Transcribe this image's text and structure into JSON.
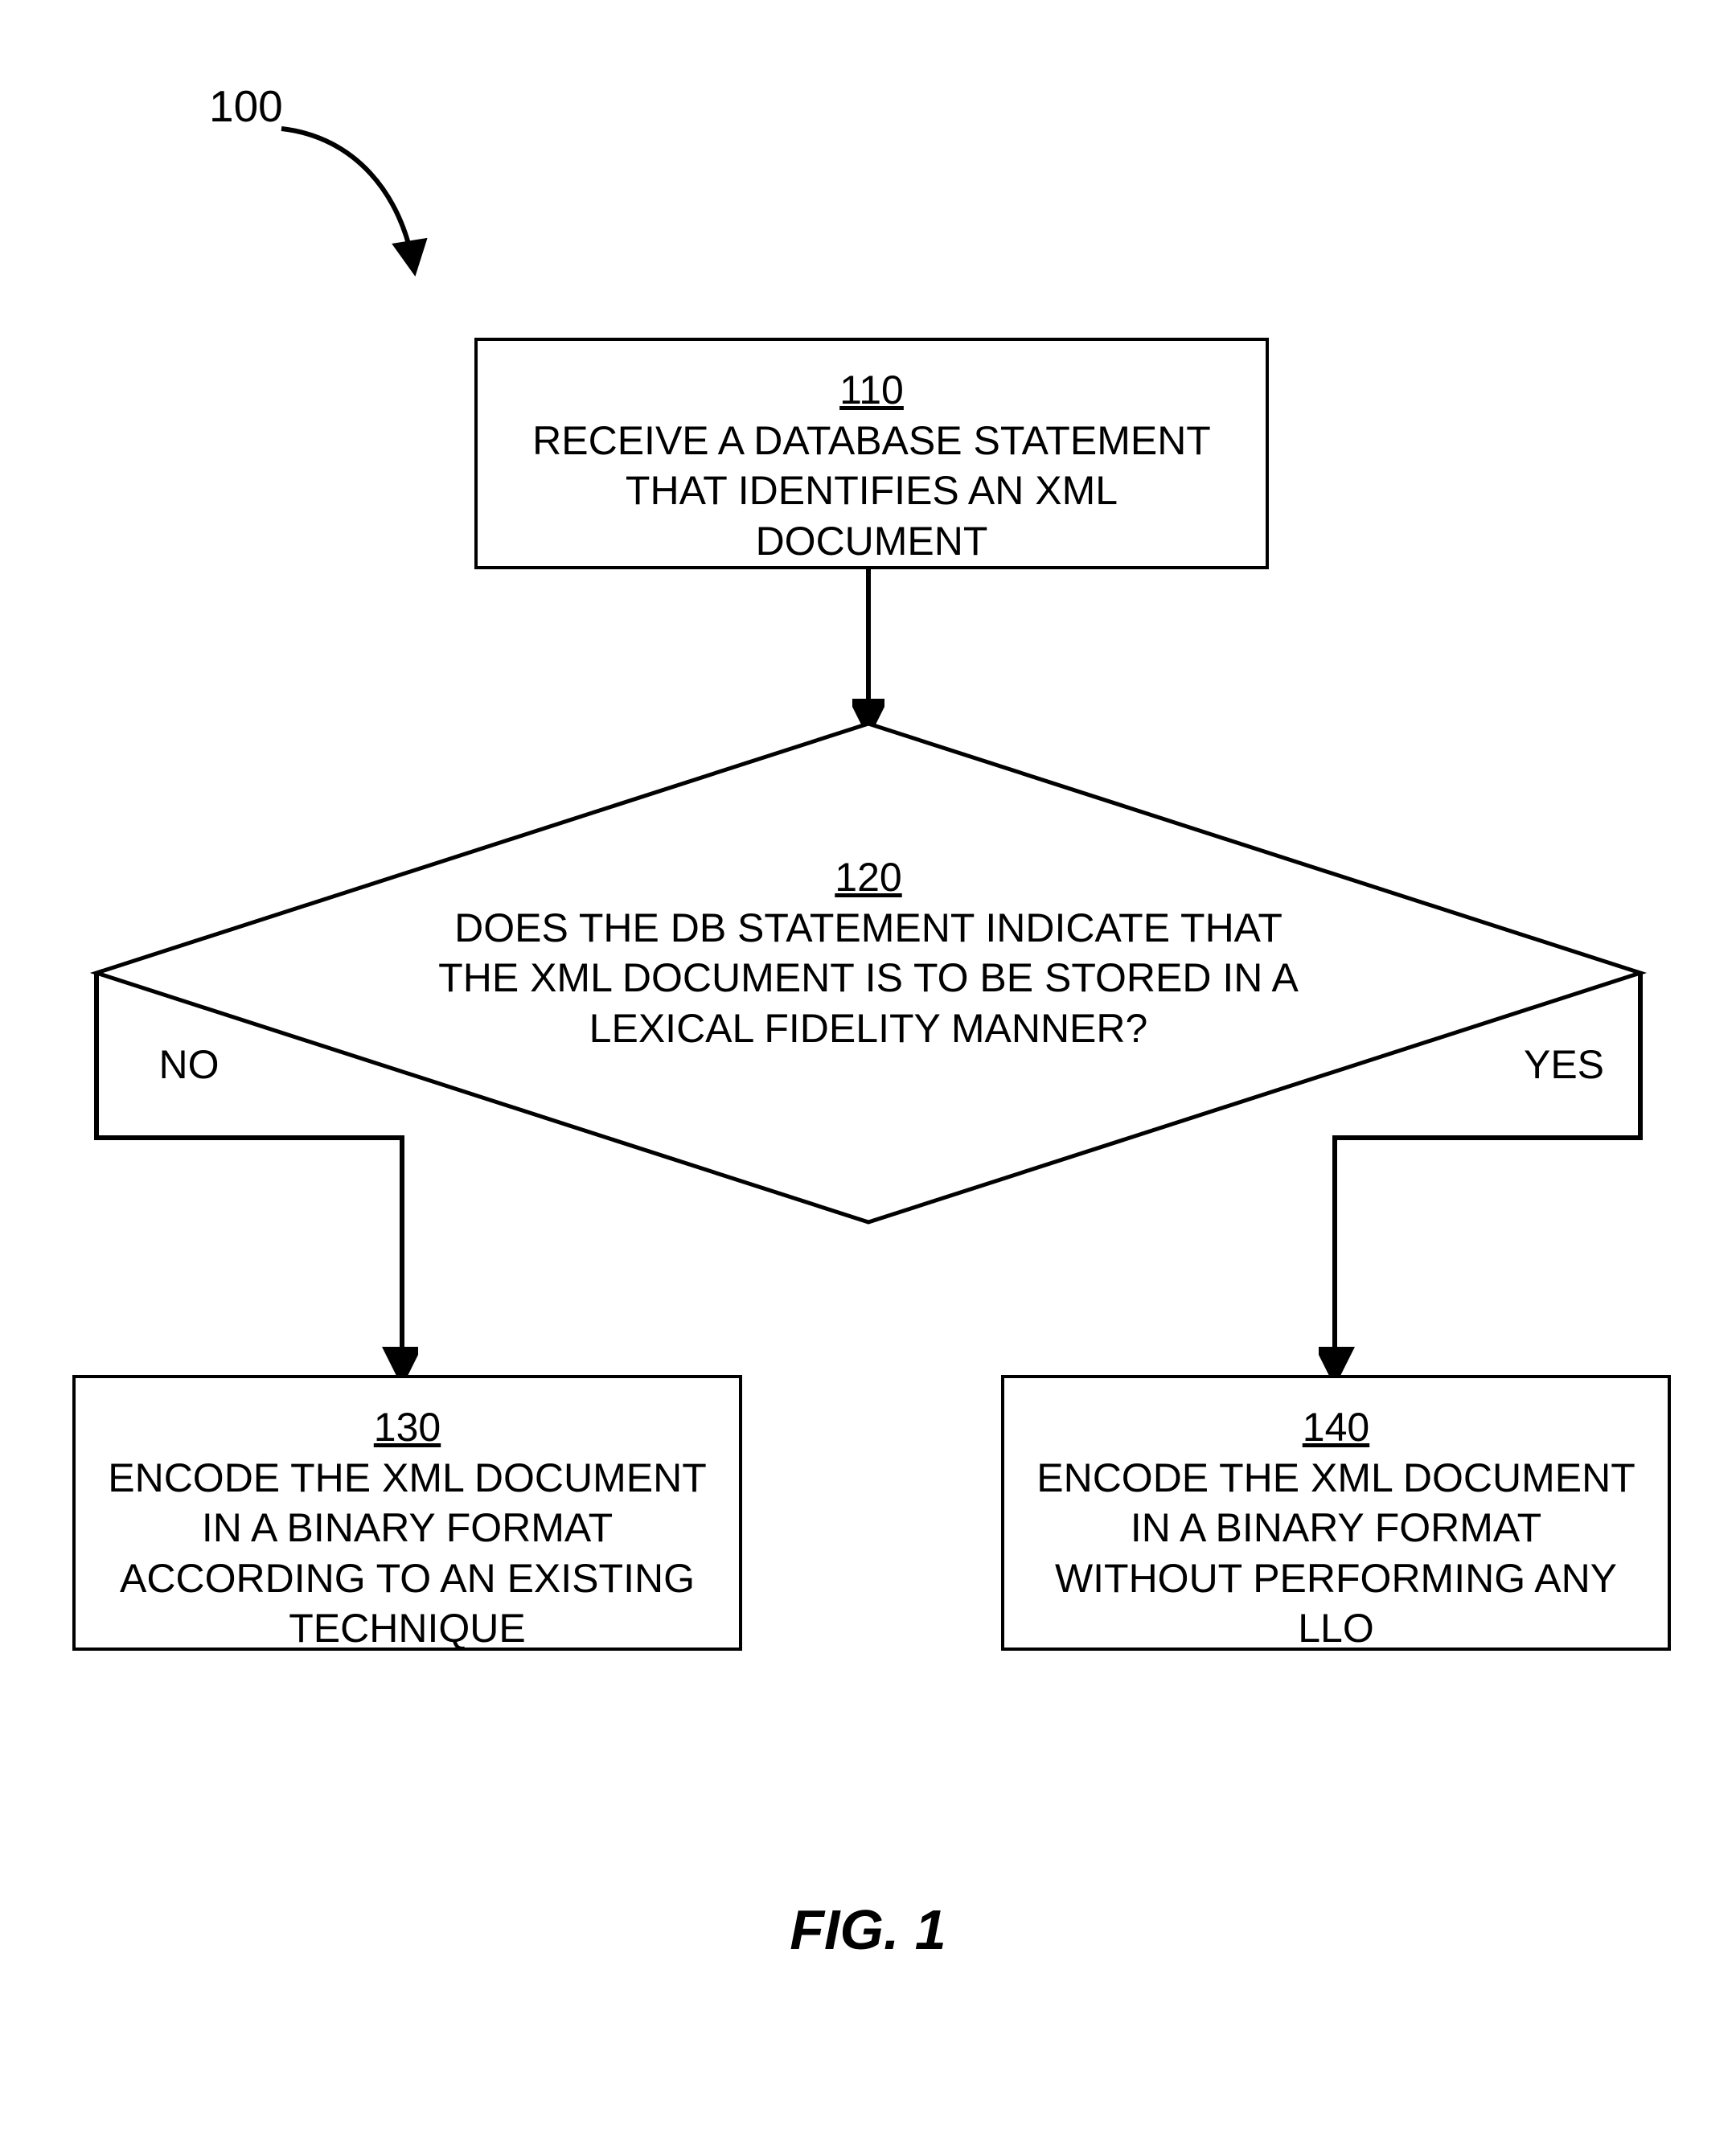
{
  "ref": "100",
  "nodes": {
    "n110": {
      "num": "110",
      "text": "RECEIVE A DATABASE STATEMENT THAT IDENTIFIES AN XML DOCUMENT"
    },
    "n120": {
      "num": "120",
      "text": "DOES THE DB STATEMENT INDICATE THAT THE XML DOCUMENT IS TO BE STORED IN A LEXICAL FIDELITY MANNER?"
    },
    "n130": {
      "num": "130",
      "text": "ENCODE THE XML DOCUMENT IN A BINARY FORMAT ACCORDING TO AN EXISTING TECHNIQUE"
    },
    "n140": {
      "num": "140",
      "text": "ENCODE THE XML DOCUMENT IN A BINARY FORMAT WITHOUT PERFORMING ANY LLO"
    }
  },
  "edges": {
    "no": "NO",
    "yes": "YES"
  },
  "figure": "FIG. 1"
}
